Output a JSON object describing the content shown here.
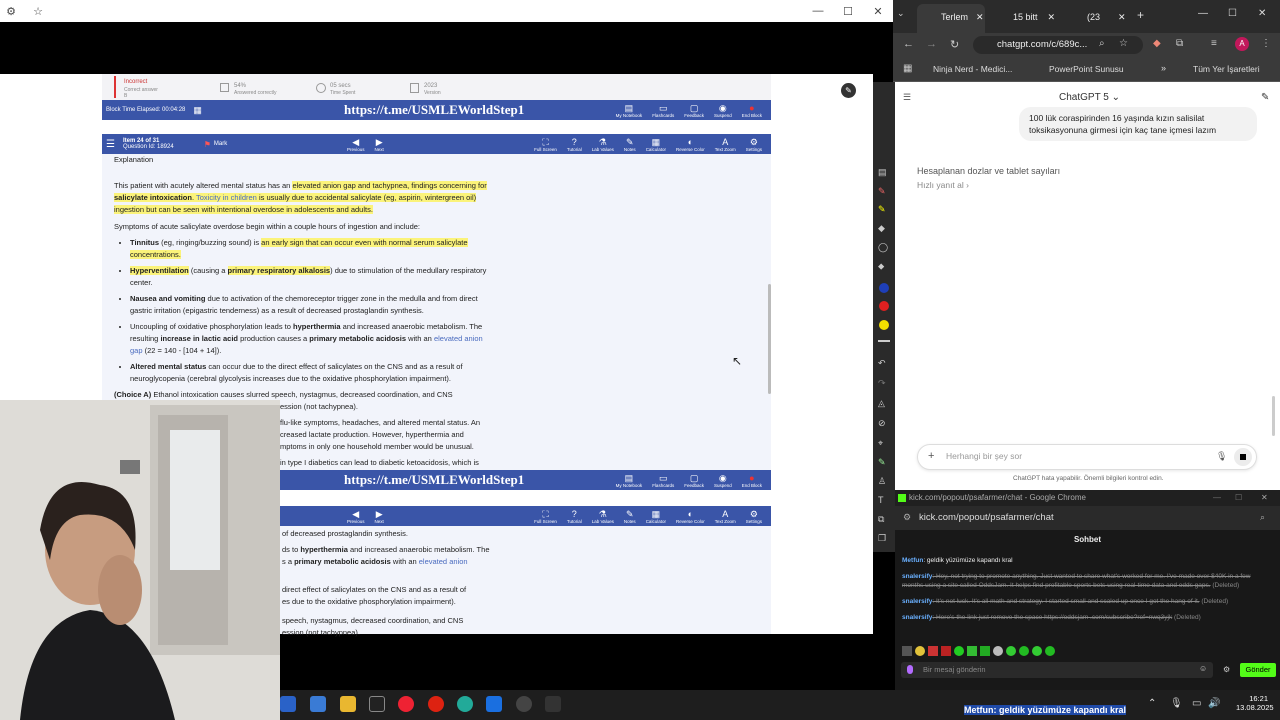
{
  "left_window": {
    "qbank": {
      "top_status": {
        "result": "Incorrect",
        "result_sub": "Correct answer",
        "result_letter": "B",
        "percent": "54%",
        "percent_label": "Answered correctly",
        "time": "05 secs",
        "time_label": "Time Spent",
        "year": "2023",
        "year_label": "Version"
      },
      "block_time": "Block Time Elapsed: 00:04:28",
      "watermark": "https://t.me/USMLEWorldStep1",
      "toolbar_right": [
        "My Notebook",
        "Flashcards",
        "Feedback",
        "Suspend",
        "End Block"
      ],
      "item": "Item 24 of 31",
      "question_id": "Question Id: 18924",
      "mark": "Mark",
      "nav": [
        "Previous",
        "Next"
      ],
      "tools": [
        "Full Screen",
        "Tutorial",
        "Lab Values",
        "Notes",
        "Calculator",
        "Reverse Color",
        "Text Zoom",
        "Settings"
      ],
      "explanation_label": "Explanation",
      "para1_a": "This patient with acutely altered mental status has an ",
      "para1_b": "elevated anion gap and tachypnea, findings concerning for",
      "para1_c": "salicylate intoxication",
      "para1_d": ".  ",
      "para1_e": "Toxicity in children",
      "para1_f": " is usually due to accidental salicylate (eg, aspirin, wintergreen oil)",
      "para1_g": "ingestion but can be seen with intentional overdose in adolescents and adults.",
      "para2": "Symptoms of acute salicylate overdose begin within a couple hours of ingestion and include:",
      "b1_bold": "Tinnitus",
      "b1_a": " (eg, ringing/buzzing sound) is ",
      "b1_b": "an early sign that can occur even with normal serum salicylate",
      "b1_c": "concentrations.",
      "b2_bold": "Hyperventilation",
      "b2_a": " (causing a ",
      "b2_b": "primary respiratory alkalosis",
      "b2_c": ") due to stimulation of the medullary respiratory",
      "b2_d": "center.",
      "b3_bold": "Nausea and vomiting",
      "b3_a": " due to activation of the chemoreceptor trigger zone in the medulla and from direct",
      "b3_b": "gastric irritation (epigastric tenderness) as a result of decreased prostaglandin synthesis.",
      "b4_a": "Uncoupling of oxidative phosphorylation leads to ",
      "b4_bold1": "hyperthermia",
      "b4_b": " and increased anaerobic metabolism.  The",
      "b4_c": "resulting ",
      "b4_bold2": "increase in lactic acid",
      "b4_d": " production causes a ",
      "b4_bold3": "primary metabolic acidosis",
      "b4_e": " with an ",
      "b4_link": "elevated anion",
      "b4_link2": "gap",
      "b4_f": " (22 = 140 - [104 + 14]).",
      "b5_bold": "Altered mental status",
      "b5_a": " can occur due to the direct effect of salicylates on the CNS and as a result of",
      "b5_b": "neuroglycopenia (cerebral glycolysis increases due to the oxidative phosphorylation impairment).",
      "choiceA_bold": "(Choice A)",
      "choiceA": " Ethanol intoxication causes slurred speech, nystagmus, decreased coordination, and CNS",
      "choiceA2": "ession (not tachypnea).",
      "choiceB": "flu-like symptoms, headaches, and altered mental status.  An",
      "choiceB2": "creased lactate production.  However, hyperthermia and",
      "choiceB3": "mptoms in only one household member would be unusual.",
      "choiceC": "in type I diabetics can lead to diabetic ketoacidosis, which is",
      "lower_1": "of decreased prostaglandin synthesis.",
      "lower_2a": "ds to ",
      "lower_2b": " and increased anaerobic metabolism.  The",
      "lower_3a": "s a ",
      "lower_3b": " with an ",
      "lower_4": "direct effect of salicylates on the CNS and as a result of",
      "lower_5": "es due to the oxidative phosphorylation impairment).",
      "lower_6": "speech, nystagmus, decreased coordination, and CNS",
      "lower_7": "ession (not tachypnea)."
    }
  },
  "chrome": {
    "tabs": [
      "Terlem",
      "15 bitt",
      "(23"
    ],
    "url": "chatgpt.com/c/689c...",
    "bookmarks": [
      "Ninja Nerd - Medici...",
      "PowerPoint Sunusu"
    ],
    "all_bookmarks": "Tüm Yer İşaretleri",
    "app_title": "ChatGPT 5",
    "user_message_1": "100 lük coraspirinden 16 yaşında kızın salisilat",
    "user_message_2": "toksikasyonuna girmesi için kaç tane içmesi lazım",
    "assistant_status": "Hesaplanan dozlar ve tablet sayıları",
    "quick_reply": "Hızlı yanıt al",
    "input_placeholder": "Herhangi bir şey sor",
    "disclaimer": "ChatGPT hata yapabilir. Önemli bilgileri kontrol edin.",
    "avatar_letter": "A"
  },
  "kick": {
    "window_title": "kick.com/popout/psafarmer/chat - Google Chrome",
    "url": "kick.com/popout/psafarmer/chat",
    "chat_title": "Sohbet",
    "messages": [
      {
        "user": "Metfun",
        "text": ": geldik yüzümüze kapandı kral"
      },
      {
        "user": "snalersify",
        "text": ": Hey, not trying to promote anything. Just wanted to share what's worked for me. I've made over $40K in a few months using a site called OddsJam. It helps find profitable sports bets using real-time data and odds gaps.",
        "tag": "(Deleted)"
      },
      {
        "user": "snalersify",
        "text": ": It's not luck. It's all math and strategy. I started small and scaled up once I got the hang of it.",
        "tag": "(Deleted)"
      },
      {
        "user": "snalersify",
        "text": ": Here's the link just remove the space https://oddsjam .com/subscribe?ref=nwq3yjk",
        "tag": "(Deleted)"
      }
    ],
    "input_placeholder": "Bir mesaj gönderin",
    "send": "Gönder"
  },
  "taskbar": {
    "time": "16:21",
    "date": "13.08.2025",
    "overlay_user": "Metfun",
    "overlay_text": ": geldik yüzümüze kapandı kral"
  },
  "colors": {
    "qbank_blue": "#3a55a8",
    "highlight": "#fbf37a",
    "kick_green": "#53fc18"
  }
}
